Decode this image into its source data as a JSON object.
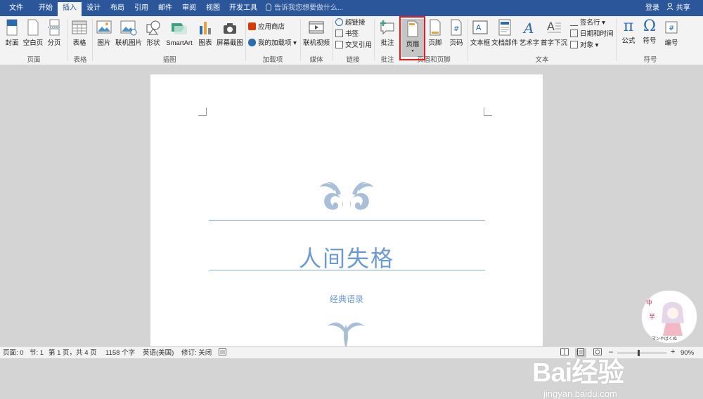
{
  "tabs": [
    {
      "label": "文件",
      "x": 0
    },
    {
      "label": "开始"
    },
    {
      "label": "插入",
      "active": true
    },
    {
      "label": "设计"
    },
    {
      "label": "布局"
    },
    {
      "label": "引用"
    },
    {
      "label": "邮件"
    },
    {
      "label": "审阅"
    },
    {
      "label": "视图"
    },
    {
      "label": "开发工具"
    }
  ],
  "tell_me": "告诉我您想要做什么...",
  "login": "登录",
  "share": "共享",
  "ribbon": {
    "cover": "封面",
    "blank_page": "空白页",
    "page_break": "分页",
    "table": "表格",
    "picture": "图片",
    "online_picture": "联机图片",
    "shapes": "形状",
    "smartart": "SmartArt",
    "chart": "图表",
    "screenshot": "屏幕截图",
    "store": "应用商店",
    "my_addins": "我的加载项",
    "online_video": "联机视频",
    "hyperlink": "超链接",
    "bookmark": "书签",
    "cross_ref": "交叉引用",
    "comment": "批注",
    "header": "页眉",
    "footer": "页脚",
    "page_number": "页码",
    "textbox": "文本框",
    "quick_parts": "文档部件",
    "wordart": "艺术字",
    "drop_cap": "首字下沉",
    "signature": "签名行",
    "datetime": "日期和时间",
    "object": "对象",
    "equation": "公式",
    "symbol": "符号",
    "numbering": "编号",
    "groups": {
      "pages": "页面",
      "tables": "表格",
      "illustrations": "插图",
      "addins": "加载项",
      "media": "媒体",
      "links": "链接",
      "comments": "批注",
      "header_footer": "页眉和页脚",
      "text": "文本",
      "symbols": "符号"
    }
  },
  "document": {
    "title": "人间失格",
    "subtitle": "经典语录"
  },
  "watermark": {
    "logo": "Bai经验",
    "url": "jingyan.baidu.com"
  },
  "status": {
    "page": "页面: 0",
    "section": "节: 1",
    "pages": "第 1 页，共 4 页",
    "words": "1158 个字",
    "language": "英语(美国)",
    "track": "修订: 关闭",
    "zoom": "90%"
  },
  "colors": {
    "accent": "#2b579a",
    "title_blue": "#6b9bd1",
    "highlight": "#e31c1c"
  }
}
